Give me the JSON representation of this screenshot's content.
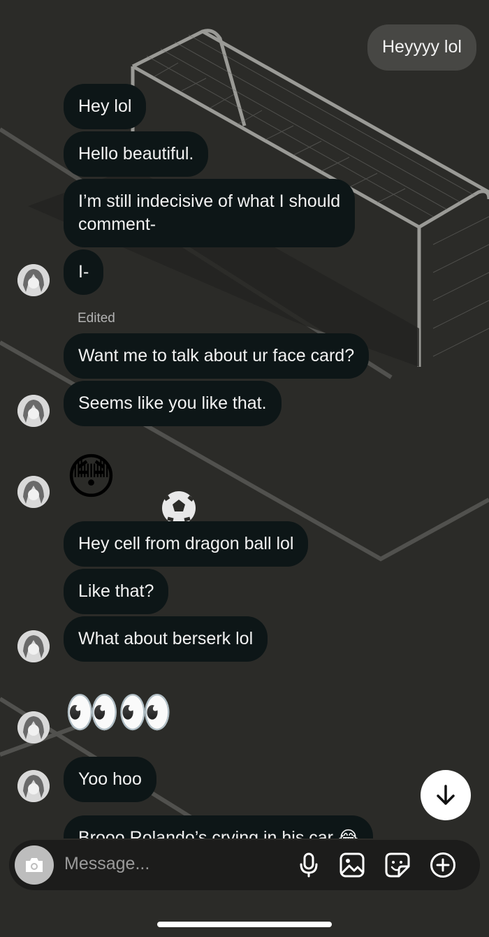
{
  "messages": {
    "outgoing_1": "Heyyyy lol",
    "m1": "Hey lol",
    "m2": "Hello beautiful.",
    "m3_line1": "I’m still indecisive of what I should",
    "m3_line2": "comment-",
    "m4": "I-",
    "edited_label": "Edited",
    "m5": "Want me to talk about ur face card?",
    "m6": "Seems like you like that.",
    "emoji_1": "😳",
    "m7": "Hey cell from dragon ball lol",
    "m8": "Like that?",
    "m9": "What about berserk lol",
    "emoji_2": "👀👀",
    "m10": "Yoo hoo",
    "m11_partial": "Brooo Rolando’s crying in his car 😂"
  },
  "composer": {
    "placeholder": "Message...",
    "icons": [
      "camera-icon",
      "microphone-icon",
      "gallery-icon",
      "sticker-icon",
      "add-icon"
    ]
  },
  "scroll_button_icon": "arrow-down-icon",
  "colors": {
    "background": "#2b2b28",
    "incoming_bubble": "#0d1617",
    "outgoing_bubble": "#474744"
  }
}
